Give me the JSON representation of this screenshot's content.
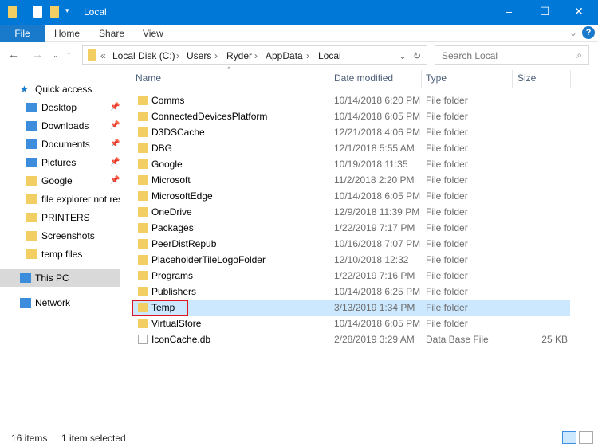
{
  "window": {
    "title": "Local"
  },
  "ribbon": {
    "file": "File",
    "tabs": [
      "Home",
      "Share",
      "View"
    ],
    "help": "?"
  },
  "address": {
    "prefix": "«",
    "crumbs": [
      "Local Disk (C:)",
      "Users",
      "Ryder",
      "AppData",
      "Local"
    ],
    "search_placeholder": "Search Local"
  },
  "sidebar": {
    "items": [
      {
        "label": "Quick access",
        "icon": "star-icon",
        "pinned": false
      },
      {
        "label": "Desktop",
        "icon": "desktop-icon",
        "pinned": true
      },
      {
        "label": "Downloads",
        "icon": "download-icon",
        "pinned": true
      },
      {
        "label": "Documents",
        "icon": "documents-icon",
        "pinned": true
      },
      {
        "label": "Pictures",
        "icon": "pictures-icon",
        "pinned": true
      },
      {
        "label": "Google",
        "icon": "folder-icon",
        "pinned": true
      },
      {
        "label": "file explorer not resp",
        "icon": "folder-icon",
        "pinned": false
      },
      {
        "label": "PRINTERS",
        "icon": "folder-icon",
        "pinned": false
      },
      {
        "label": "Screenshots",
        "icon": "folder-icon",
        "pinned": false
      },
      {
        "label": "temp files",
        "icon": "folder-icon",
        "pinned": false
      },
      {
        "label": "This PC",
        "icon": "pc-icon",
        "pinned": false
      },
      {
        "label": "Network",
        "icon": "network-icon",
        "pinned": false
      }
    ]
  },
  "columns": {
    "name": "Name",
    "date": "Date modified",
    "type": "Type",
    "size": "Size"
  },
  "files": [
    {
      "name": "Comms",
      "date": "10/14/2018 6:20 PM",
      "type": "File folder",
      "size": ""
    },
    {
      "name": "ConnectedDevicesPlatform",
      "date": "10/14/2018 6:05 PM",
      "type": "File folder",
      "size": ""
    },
    {
      "name": "D3DSCache",
      "date": "12/21/2018 4:06 PM",
      "type": "File folder",
      "size": ""
    },
    {
      "name": "DBG",
      "date": "12/1/2018 5:55 AM",
      "type": "File folder",
      "size": ""
    },
    {
      "name": "Google",
      "date": "10/19/2018 11:35",
      "type": "File folder",
      "size": ""
    },
    {
      "name": "Microsoft",
      "date": "11/2/2018 2:20 PM",
      "type": "File folder",
      "size": ""
    },
    {
      "name": "MicrosoftEdge",
      "date": "10/14/2018 6:05 PM",
      "type": "File folder",
      "size": ""
    },
    {
      "name": "OneDrive",
      "date": "12/9/2018 11:39 PM",
      "type": "File folder",
      "size": ""
    },
    {
      "name": "Packages",
      "date": "1/22/2019 7:17 PM",
      "type": "File folder",
      "size": ""
    },
    {
      "name": "PeerDistRepub",
      "date": "10/16/2018 7:07 PM",
      "type": "File folder",
      "size": ""
    },
    {
      "name": "PlaceholderTileLogoFolder",
      "date": "12/10/2018 12:32",
      "type": "File folder",
      "size": ""
    },
    {
      "name": "Programs",
      "date": "1/22/2019 7:16 PM",
      "type": "File folder",
      "size": ""
    },
    {
      "name": "Publishers",
      "date": "10/14/2018 6:25 PM",
      "type": "File folder",
      "size": ""
    },
    {
      "name": "Temp",
      "date": "3/13/2019 1:34 PM",
      "type": "File folder",
      "size": "",
      "selected": true
    },
    {
      "name": "VirtualStore",
      "date": "10/14/2018 6:05 PM",
      "type": "File folder",
      "size": ""
    },
    {
      "name": "IconCache.db",
      "date": "2/28/2019 3:29 AM",
      "type": "Data Base File",
      "size": "25 KB"
    }
  ],
  "status": {
    "count": "16 items",
    "selection": "1 item selected"
  },
  "colors": {
    "accent": "#0078d7",
    "selection": "#cce8ff",
    "highlight": "#e0141e"
  }
}
